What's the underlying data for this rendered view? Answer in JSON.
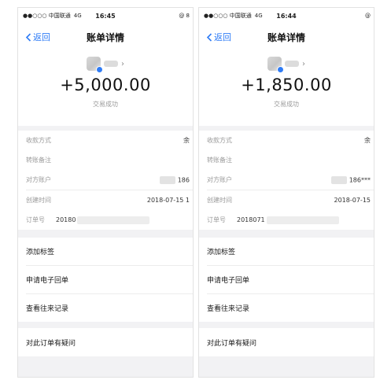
{
  "phones": [
    {
      "status": {
        "carrier": "●●○○○ 中国联通",
        "network": "4G",
        "time": "16:45",
        "right": "@ 8"
      },
      "nav": {
        "back": "返回",
        "title": "账单详情"
      },
      "hero": {
        "amount": "+5,000.00",
        "status": "交易成功"
      },
      "details": {
        "pay_method": {
          "label": "收款方式",
          "value": "余"
        },
        "note": {
          "label": "转账备注"
        },
        "account": {
          "label": "对方账户",
          "value": "186"
        },
        "created": {
          "label": "创建时间",
          "value": "2018-07-15 1"
        },
        "order": {
          "label": "订单号",
          "value": "20180"
        }
      },
      "actions": [
        "添加标签",
        "申请电子回单",
        "查看往来记录"
      ],
      "question": "对此订单有疑问"
    },
    {
      "status": {
        "carrier": "●●○○○ 中国联通",
        "network": "4G",
        "time": "16:44",
        "right": "@"
      },
      "nav": {
        "back": "返回",
        "title": "账单详情"
      },
      "hero": {
        "amount": "+1,850.00",
        "status": "交易成功"
      },
      "details": {
        "pay_method": {
          "label": "收款方式",
          "value": "余"
        },
        "note": {
          "label": "转账备注"
        },
        "account": {
          "label": "对方账户",
          "value": "186***"
        },
        "created": {
          "label": "创建时间",
          "value": "2018-07-15"
        },
        "order": {
          "label": "订单号",
          "value": "2018071"
        }
      },
      "actions": [
        "添加标签",
        "申请电子回单",
        "查看往来记录"
      ],
      "question": "对此订单有疑问"
    }
  ],
  "colors": {
    "accent": "#2f7cf6",
    "background": "#f2f2f4",
    "muted_text": "#9a9a9a"
  },
  "icons": [
    "back-chevron-icon",
    "avatar-verified-icon",
    "chevron-right-icon"
  ]
}
